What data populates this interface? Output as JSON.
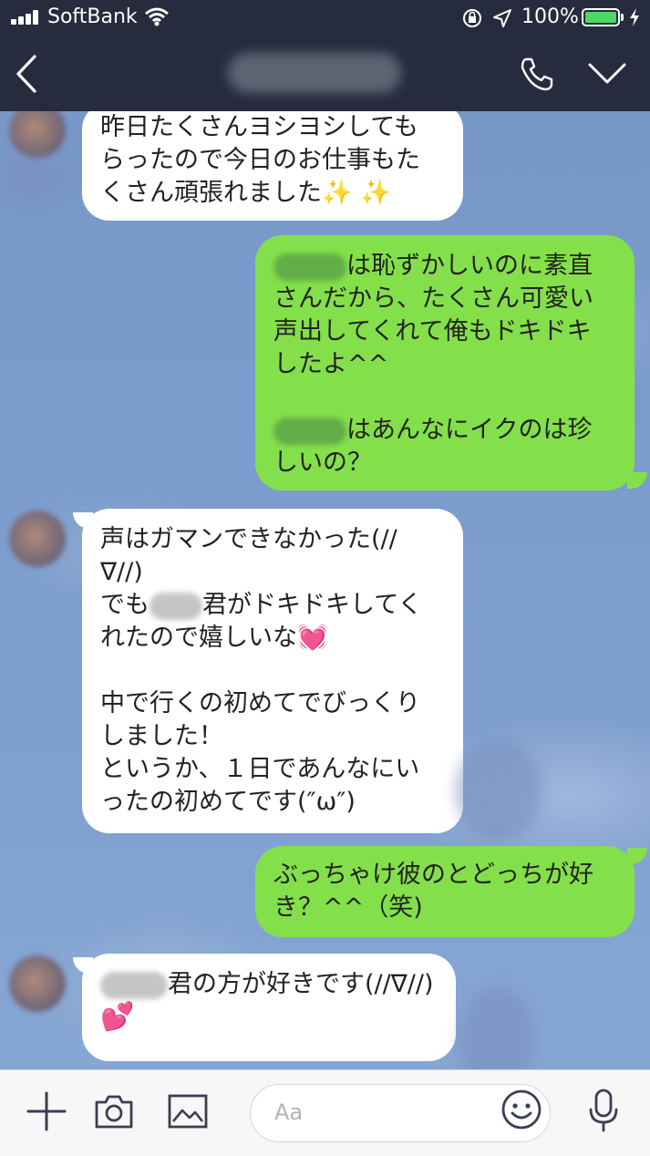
{
  "status_bar": {
    "carrier": "SoftBank",
    "battery": "100%",
    "battery_level": 1.0,
    "time": ""
  },
  "header": {
    "contact_name": "",
    "back_icon": "chevron-left-icon",
    "call_icon": "phone-icon",
    "menu_icon": "chevron-down-icon"
  },
  "messages": [
    {
      "from": "them",
      "lines": [
        "昨日たくさんヨシヨシしても",
        "らったので今日のお仕事もた",
        "くさん頑張れました✨ ✨"
      ]
    },
    {
      "from": "me",
      "lines": [
        "は恥ずかしいのに素直",
        "さんだから、たくさん可愛い",
        "声出してくれて俺もドキドキ",
        "したよ^^",
        "",
        "はあんなにイクのは珍",
        "しいの？"
      ]
    },
    {
      "from": "them",
      "lines": [
        "声はガマンできなかった(//",
        "∇//)",
        "でも",
        "君がドキドキしてく",
        "れたので嬉しいな💓",
        "",
        "中で行くの初めてでびっくり",
        "しました！",
        "というか、１日であんなにい",
        "ったの初めてです(″ω″)"
      ]
    },
    {
      "from": "me",
      "lines": [
        "ぶっちゃけ彼のとどっちが好",
        "き？^^（笑)"
      ]
    },
    {
      "from": "them",
      "lines": [
        "君の方が好きです(//∇//)",
        "💕"
      ]
    }
  ],
  "input_bar": {
    "placeholder": "Aa",
    "icons": [
      "plus-icon",
      "camera-icon",
      "image-icon",
      "emoji-icon",
      "microphone-icon"
    ]
  },
  "colors": {
    "header_bg": "#262c3d",
    "chat_bg": "#7c9dcd",
    "incoming_bubble": "#ffffff",
    "outgoing_bubble": "#84e04a",
    "battery_green": "#4cd964"
  }
}
